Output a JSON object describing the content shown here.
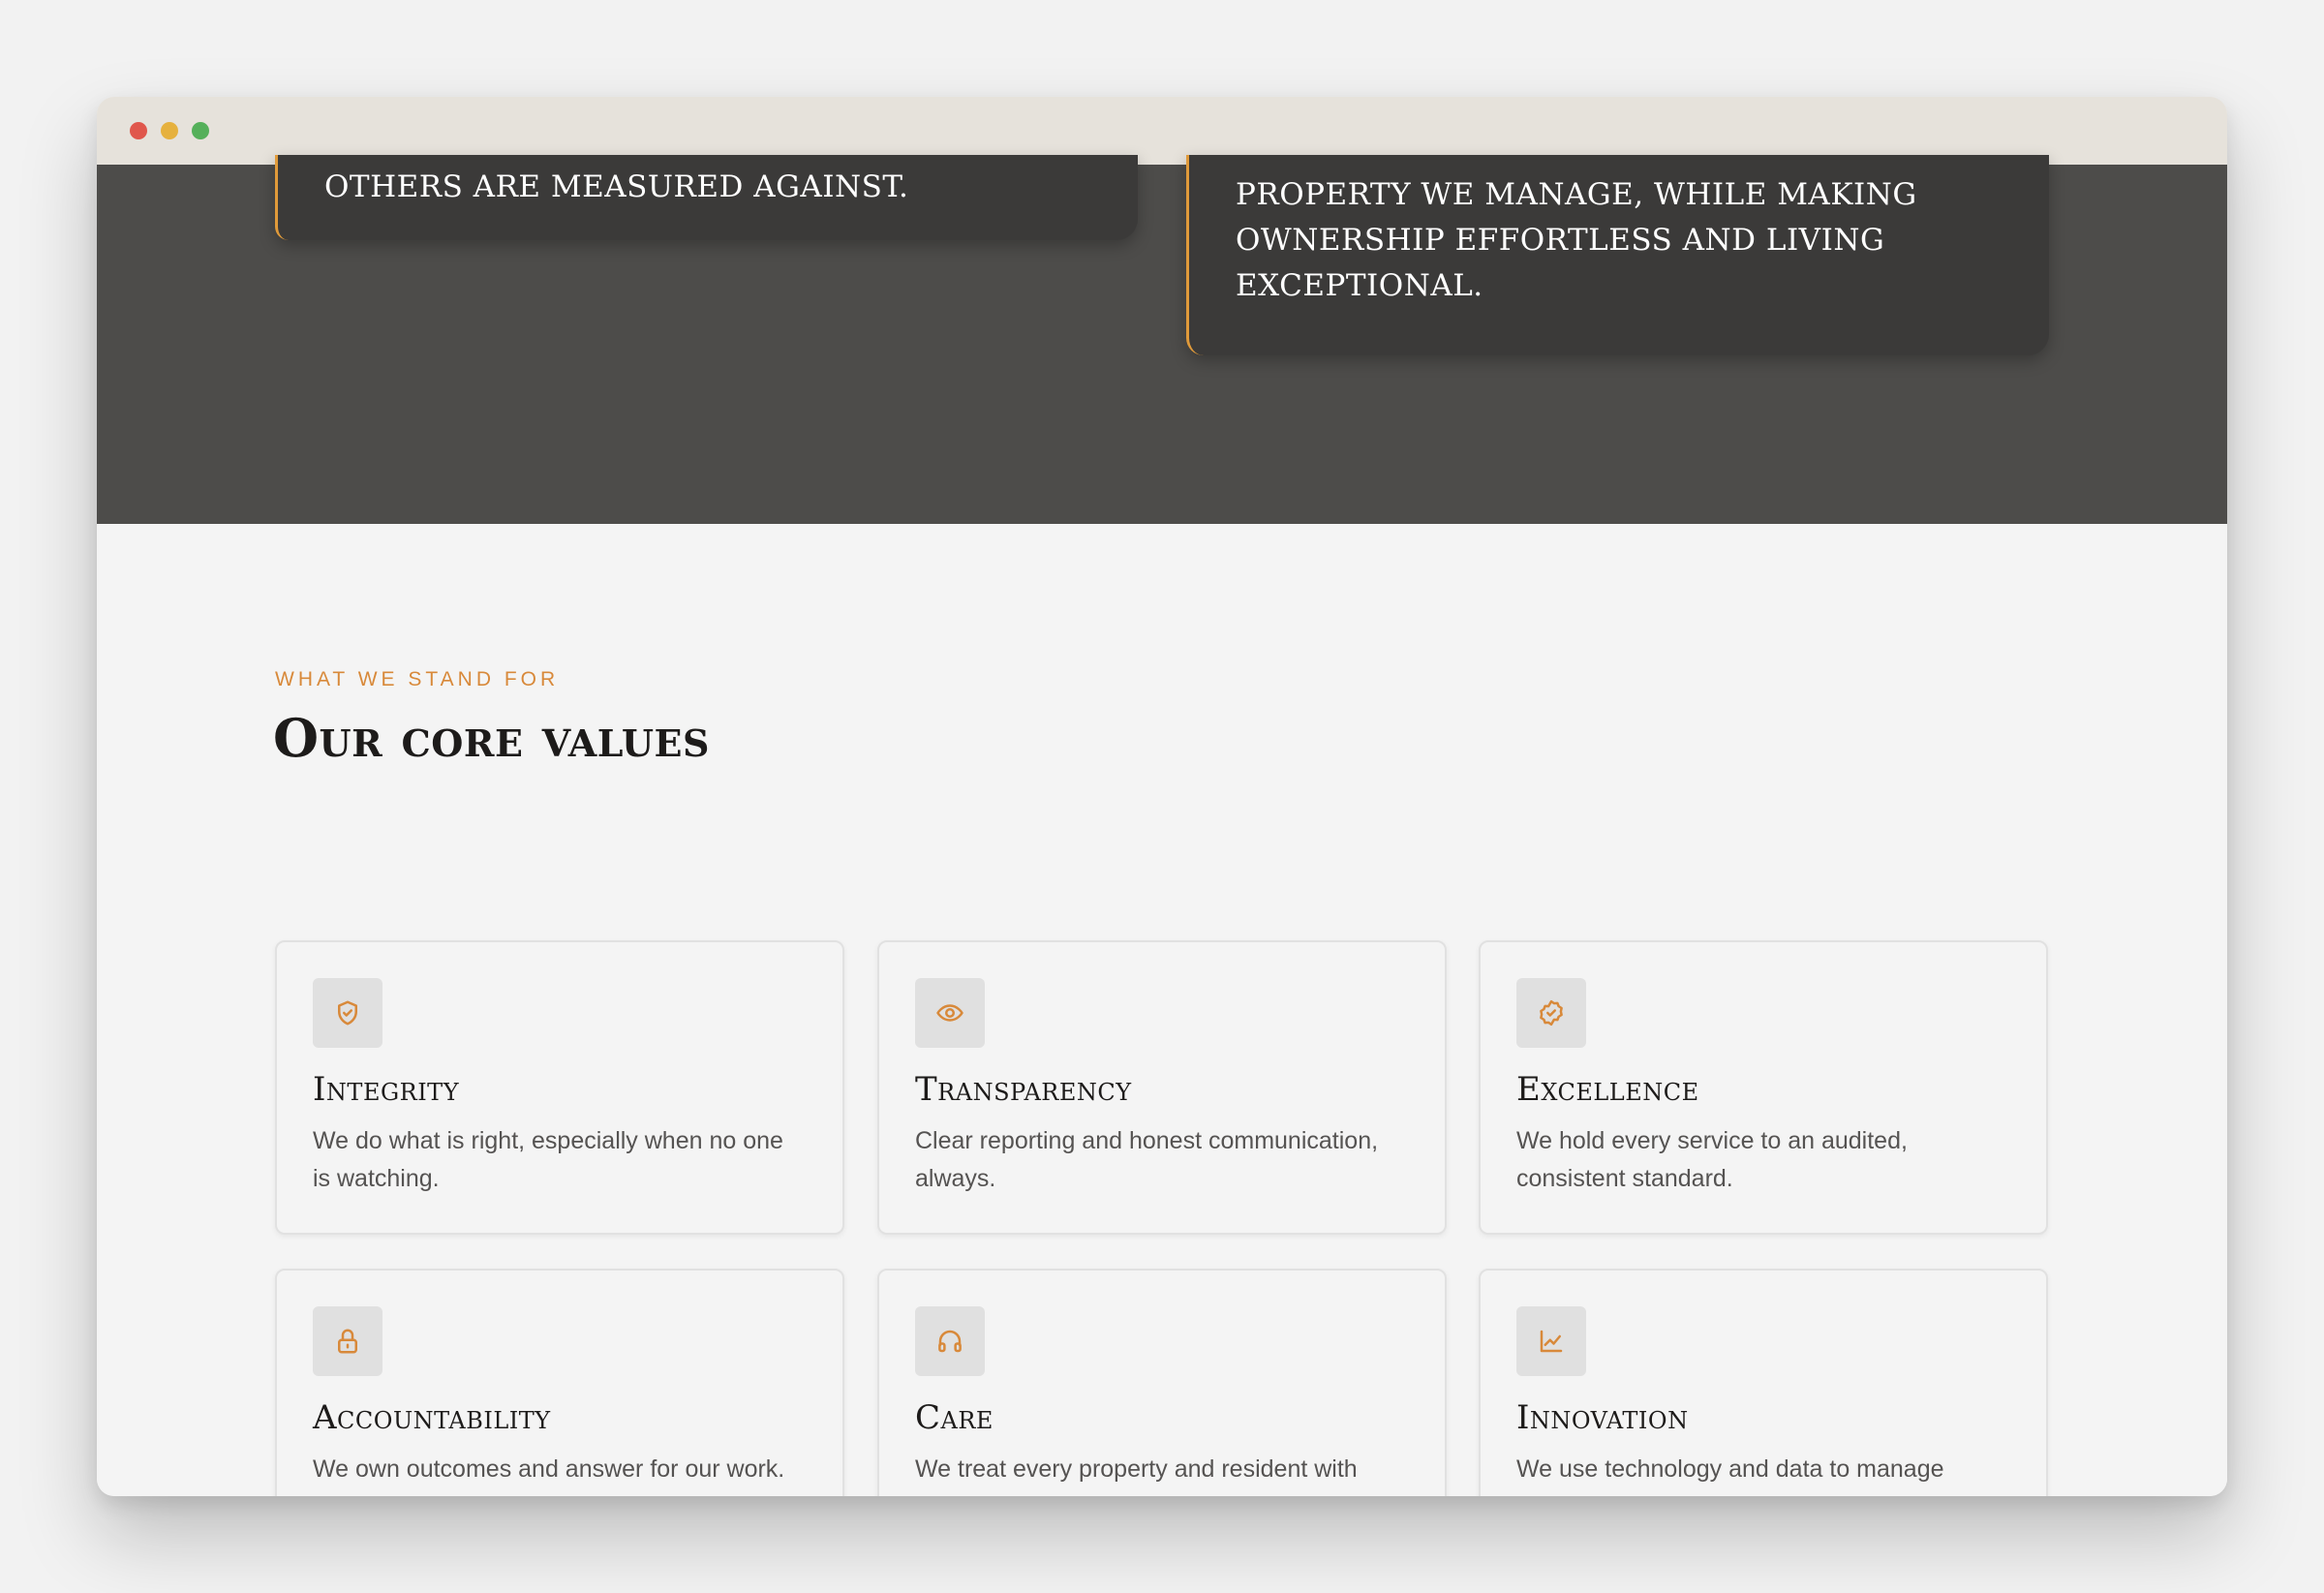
{
  "window": {
    "controls": [
      "close",
      "minimize",
      "maximize"
    ]
  },
  "mission": {
    "left_quote": "Others are measured against.",
    "right_quote": "property we manage, while making ownership effortless and living exceptional."
  },
  "values": {
    "eyebrow": "What we stand for",
    "heading": "Our core values",
    "items": [
      {
        "title": "Integrity",
        "description": "We do what is right, especially when no one is watching.",
        "icon": "shield-check-icon"
      },
      {
        "title": "Transparency",
        "description": "Clear reporting and honest communication, always.",
        "icon": "eye-icon"
      },
      {
        "title": "Excellence",
        "description": "We hold every service to an audited, consistent standard.",
        "icon": "badge-check-icon"
      },
      {
        "title": "Accountability",
        "description": "We own outcomes and answer for our work.",
        "icon": "lock-icon"
      },
      {
        "title": "Care",
        "description": "We treat every property and resident with genuine respect.",
        "icon": "headphones-icon"
      },
      {
        "title": "Innovation",
        "description": "We use technology and data to manage smarter.",
        "icon": "line-chart-icon"
      }
    ]
  },
  "colors": {
    "accent": "#d8893a",
    "dark_band": "#4d4c4a",
    "card_dark": "#3b3a39"
  }
}
